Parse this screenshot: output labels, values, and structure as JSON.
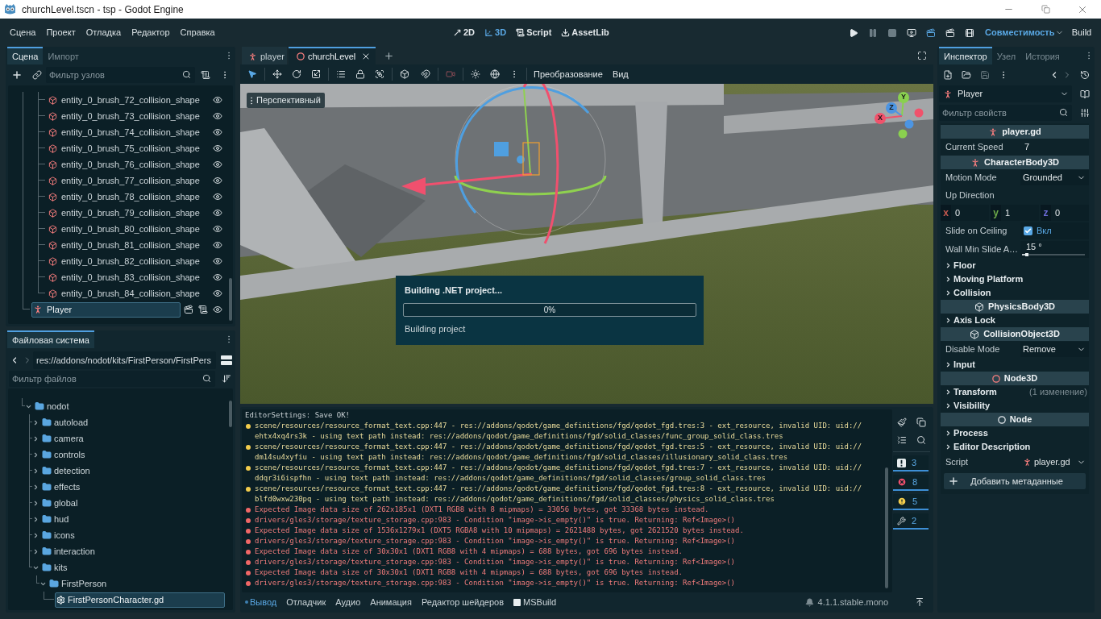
{
  "window": {
    "title": "churchLevel.tscn - tsp - Godot Engine"
  },
  "menu": [
    "Сцена",
    "Проект",
    "Отладка",
    "Редактор",
    "Справка"
  ],
  "workspaces": [
    {
      "label": "2D",
      "selected": false
    },
    {
      "label": "3D",
      "selected": true
    },
    {
      "label": "Script",
      "selected": false
    },
    {
      "label": "AssetLib",
      "selected": false
    }
  ],
  "run_buttons": [
    {
      "active": false,
      "disabled": false
    },
    {
      "active": false,
      "disabled": true
    },
    {
      "active": false,
      "disabled": true
    },
    {
      "active": false,
      "disabled": false
    },
    {
      "active": true,
      "disabled": false
    },
    {
      "active": false,
      "disabled": false
    },
    {
      "active": false,
      "disabled": false
    }
  ],
  "renderer": "Совместимость",
  "build_button": "Build",
  "scene_dock": {
    "tabs": [
      {
        "label": "Сцена",
        "selected": true
      },
      {
        "label": "Импорт",
        "selected": false
      }
    ],
    "filter": {
      "placeholder": "Фильтр узлов"
    },
    "tree": [
      {
        "children": [
          {
            "label": "entity_0_brush_72_collision_shape",
            "selected": false
          },
          {
            "label": "entity_0_brush_73_collision_shape",
            "selected": false
          },
          {
            "label": "entity_0_brush_74_collision_shape",
            "selected": false
          },
          {
            "label": "entity_0_brush_75_collision_shape",
            "selected": false
          },
          {
            "label": "entity_0_brush_76_collision_shape",
            "selected": false
          },
          {
            "label": "entity_0_brush_77_collision_shape",
            "selected": false
          },
          {
            "label": "entity_0_brush_78_collision_shape",
            "selected": false
          },
          {
            "label": "entity_0_brush_79_collision_shape",
            "selected": false
          },
          {
            "label": "entity_0_brush_80_collision_shape",
            "selected": false
          },
          {
            "label": "entity_0_brush_81_collision_shape",
            "selected": false
          },
          {
            "label": "entity_0_brush_82_collision_shape",
            "selected": false
          },
          {
            "label": "entity_0_brush_83_collision_shape",
            "selected": false
          },
          {
            "label": "entity_0_brush_84_collision_shape",
            "selected": false
          }
        ]
      },
      {
        "label": "Player",
        "selected": true
      }
    ]
  },
  "filesystem_dock": {
    "tabs": [
      {
        "label": "Файловая система",
        "selected": true
      }
    ],
    "path": "res://addons/nodot/kits/FirstPerson/FirstPers",
    "filter": {
      "placeholder": "Фильтр файлов"
    },
    "tree": [
      {
        "label": "nodot",
        "kind": "folder",
        "expanded": true,
        "selected": false,
        "children": [
          {
            "label": "autoload",
            "kind": "folder",
            "expanded": false,
            "selected": false
          },
          {
            "label": "camera",
            "kind": "folder",
            "expanded": false,
            "selected": false
          },
          {
            "label": "controls",
            "kind": "folder",
            "expanded": false,
            "selected": false
          },
          {
            "label": "detection",
            "kind": "folder",
            "expanded": false,
            "selected": false
          },
          {
            "label": "effects",
            "kind": "folder",
            "expanded": false,
            "selected": false
          },
          {
            "label": "global",
            "kind": "folder",
            "expanded": false,
            "selected": false
          },
          {
            "label": "hud",
            "kind": "folder",
            "expanded": false,
            "selected": false
          },
          {
            "label": "icons",
            "kind": "folder",
            "expanded": false,
            "selected": false
          },
          {
            "label": "interaction",
            "kind": "folder",
            "expanded": false,
            "selected": false
          },
          {
            "label": "kits",
            "kind": "folder",
            "expanded": true,
            "selected": false,
            "children": [
              {
                "label": "FirstPerson",
                "kind": "folder",
                "expanded": true,
                "selected": false,
                "children": [
                  {
                    "label": "FirstPersonCharacter.gd",
                    "kind": "file",
                    "selected": true
                  }
                ]
              }
            ]
          }
        ]
      }
    ]
  },
  "editor_tabs": [
    {
      "label": "player",
      "selected": false
    },
    {
      "label": "churchLevel",
      "selected": true
    }
  ],
  "viewport_tools": [
    {
      "selected": true
    },
    {
      "selected": false
    },
    {
      "selected": false
    },
    {
      "selected": false
    }
  ],
  "viewport_menus": [
    "Преобразование",
    "Вид"
  ],
  "viewport": {
    "view_menu": "Перспективный",
    "axes": [
      {
        "label": "Y",
        "color": "#8ad04f"
      },
      {
        "label": "Z",
        "color": "#4c95e3"
      },
      {
        "label": "X",
        "color": "#f0526b"
      }
    ]
  },
  "build_dialog": {
    "title": "Building .NET project...",
    "progress": {
      "level": 0,
      "reading": "0%"
    },
    "status": "Building project"
  },
  "output": {
    "lines": [
      {
        "kind": "plain",
        "text": "EditorSettings: Save OK!"
      },
      {
        "kind": "warning",
        "text": "scene/resources/resource_format_text.cpp:447 - res://addons/qodot/game_definitions/fgd/qodot_fgd.tres:3 - ext_resource, invalid UID: uid://ehtx4xq4rs3k - using text path instead: res://addons/qodot/game_definitions/fgd/solid_classes/func_group_solid_class.tres"
      },
      {
        "kind": "warning",
        "text": "scene/resources/resource_format_text.cpp:447 - res://addons/qodot/game_definitions/fgd/qodot_fgd.tres:5 - ext_resource, invalid UID: uid://dm14su4xyfiu - using text path instead: res://addons/qodot/game_definitions/fgd/solid_classes/illusionary_solid_class.tres"
      },
      {
        "kind": "warning",
        "text": "scene/resources/resource_format_text.cpp:447 - res://addons/qodot/game_definitions/fgd/qodot_fgd.tres:7 - ext_resource, invalid UID: uid://ddqr3i6ispfhn - using text path instead: res://addons/qodot/game_definitions/fgd/solid_classes/group_solid_class.tres"
      },
      {
        "kind": "warning",
        "text": "scene/resources/resource_format_text.cpp:447 - res://addons/qodot/game_definitions/fgd/qodot_fgd.tres:8 - ext_resource, invalid UID: uid://blfd0wxw230pq - using text path instead: res://addons/qodot/game_definitions/fgd/solid_classes/physics_solid_class.tres"
      },
      {
        "kind": "error",
        "text": "Expected Image data size of 262x185x1 (DXT1 RGB8 with 8 mipmaps) = 33056 bytes, got 33368 bytes instead."
      },
      {
        "kind": "error",
        "text": "drivers/gles3/storage/texture_storage.cpp:983 - Condition \"image->is_empty()\" is true. Returning: Ref<Image>()"
      },
      {
        "kind": "error",
        "text": "Expected Image data size of 1536x1279x1 (DXT5 RGBA8 with 10 mipmaps) = 2621488 bytes, got 2621520 bytes instead."
      },
      {
        "kind": "error",
        "text": "drivers/gles3/storage/texture_storage.cpp:983 - Condition \"image->is_empty()\" is true. Returning: Ref<Image>()"
      },
      {
        "kind": "error",
        "text": "Expected Image data size of 30x30x1 (DXT1 RGB8 with 4 mipmaps) = 688 bytes, got 696 bytes instead."
      },
      {
        "kind": "error",
        "text": "drivers/gles3/storage/texture_storage.cpp:983 - Condition \"image->is_empty()\" is true. Returning: Ref<Image>()"
      },
      {
        "kind": "error",
        "text": "Expected Image data size of 30x30x1 (DXT1 RGB8 with 4 mipmaps) = 688 bytes, got 696 bytes instead."
      },
      {
        "kind": "error",
        "text": "drivers/gles3/storage/texture_storage.cpp:983 - Condition \"image->is_empty()\" is true. Returning: Ref<Image>()"
      }
    ],
    "filters": [
      {
        "count": "3",
        "on": true
      },
      {
        "count": "8",
        "on": true
      },
      {
        "count": "5",
        "on": true
      },
      {
        "count": "2",
        "on": true
      }
    ]
  },
  "bottom_tabs": [
    {
      "label": "Вывод",
      "selected": true,
      "unread": true
    },
    {
      "label": "Отладчик",
      "selected": false,
      "unread": false
    },
    {
      "label": "Аудио",
      "selected": false,
      "unread": false
    },
    {
      "label": "Анимация",
      "selected": false,
      "unread": false
    },
    {
      "label": "Редактор шейдеров",
      "selected": false,
      "unread": false
    },
    {
      "label": "MSBuild",
      "selected": false,
      "unread": false
    }
  ],
  "version": "4.1.1.stable.mono",
  "inspector": {
    "tabs": [
      {
        "label": "Инспектор",
        "selected": true
      },
      {
        "label": "Узел",
        "selected": false
      },
      {
        "label": "История",
        "selected": false
      }
    ],
    "object": "Player",
    "filter": {
      "placeholder": "Фильтр свойств"
    },
    "items": [
      {
        "kind": "category",
        "label": "player.gd"
      },
      {
        "kind": "value",
        "label": "Current Speed",
        "value": "7"
      },
      {
        "kind": "category",
        "label": "CharacterBody3D"
      },
      {
        "kind": "dropdown",
        "label": "Motion Mode",
        "value": "Grounded"
      },
      {
        "kind": "vector",
        "label": "Up Direction",
        "components": [
          {
            "axis": "x",
            "value": "0",
            "color": "#c4584f"
          },
          {
            "axis": "y",
            "value": "1",
            "color": "#6eaa4a"
          },
          {
            "axis": "z",
            "value": "0",
            "color": "#6b6bd6"
          }
        ]
      },
      {
        "kind": "checkbox",
        "label": "Slide on Ceiling",
        "checked": true,
        "value": "Вкл"
      },
      {
        "kind": "slider",
        "label": "Wall Min Slide A…",
        "value": "15 °",
        "level": 0.08
      },
      {
        "kind": "group",
        "label": "Floor",
        "expanded": false
      },
      {
        "kind": "group",
        "label": "Moving Platform",
        "expanded": false
      },
      {
        "kind": "group",
        "label": "Collision",
        "expanded": false
      },
      {
        "kind": "category",
        "label": "PhysicsBody3D"
      },
      {
        "kind": "group",
        "label": "Axis Lock",
        "expanded": false
      },
      {
        "kind": "category",
        "label": "CollisionObject3D"
      },
      {
        "kind": "dropdown",
        "label": "Disable Mode",
        "value": "Remove"
      },
      {
        "kind": "group",
        "label": "Input",
        "expanded": false
      },
      {
        "kind": "category",
        "label": "Node3D"
      },
      {
        "kind": "group",
        "label": "Transform",
        "expanded": false,
        "note": "(1 изменение)"
      },
      {
        "kind": "group",
        "label": "Visibility",
        "expanded": false
      },
      {
        "kind": "category",
        "label": "Node"
      },
      {
        "kind": "group",
        "label": "Process",
        "expanded": false
      },
      {
        "kind": "group",
        "label": "Editor Description",
        "expanded": false
      },
      {
        "kind": "resource",
        "label": "Script",
        "value": "player.gd"
      }
    ],
    "add_metadata": "Добавить метаданные"
  }
}
